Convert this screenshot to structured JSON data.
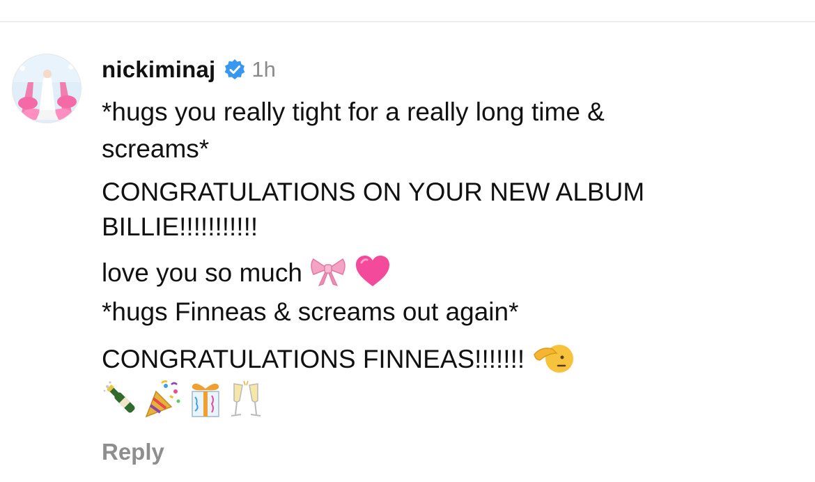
{
  "comment": {
    "username": "nickiminaj",
    "timestamp": "1h",
    "lines": [
      "*hugs you really tight for a really long time &",
      "screams*",
      "CONGRATULATIONS ON YOUR NEW ALBUM",
      "BILLIE!!!!!!!!!!!",
      "love you so much",
      "*hugs Finneas & screams out again*",
      "CONGRATULATIONS FINNEAS!!!!!!!"
    ],
    "line_5_emojis": [
      "bow-emoji",
      "pink-heart-emoji"
    ],
    "line_7_emojis": [
      "saluting-face-emoji"
    ],
    "emoji_row": [
      "champagne-bottle-emoji",
      "party-popper-emoji",
      "wrapped-gift-emoji",
      "clinking-glasses-emoji"
    ],
    "reply_label": "Reply"
  },
  "colors": {
    "username": "#111111",
    "timestamp": "#8a8a8a",
    "verified_badge": "#3897f0",
    "reply": "#8e8e8e",
    "divider": "#ececec"
  }
}
